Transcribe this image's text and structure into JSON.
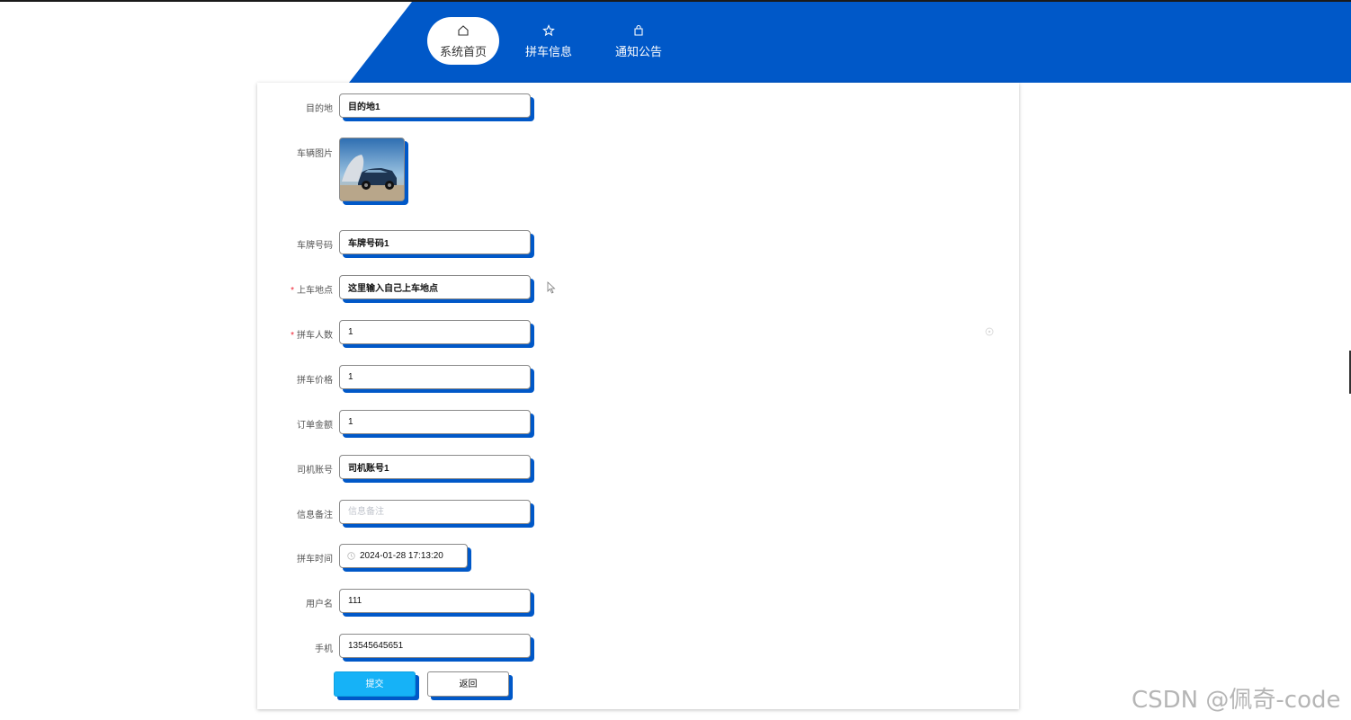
{
  "nav": {
    "items": [
      {
        "label": "系统首页",
        "icon": "home-icon",
        "active": true
      },
      {
        "label": "拼车信息",
        "icon": "star-icon",
        "active": false
      },
      {
        "label": "通知公告",
        "icon": "bag-icon",
        "active": false
      }
    ]
  },
  "colors": {
    "primary": "#0058c8",
    "submit": "#16b2f7",
    "required": "#ee2233"
  },
  "form": {
    "destination": {
      "label": "目的地",
      "value": "目的地1"
    },
    "vehicle_image": {
      "label": "车辆图片"
    },
    "plate": {
      "label": "车牌号码",
      "value": "车牌号码1"
    },
    "pickup": {
      "label": "上车地点",
      "value": "这里输入自己上车地点",
      "required": "*"
    },
    "passengers": {
      "label": "拼车人数",
      "value": "1",
      "required": "*"
    },
    "price": {
      "label": "拼车价格",
      "value": "1"
    },
    "amount": {
      "label": "订单金额",
      "value": "1"
    },
    "driver": {
      "label": "司机账号",
      "value": "司机账号1"
    },
    "remark": {
      "label": "信息备注",
      "placeholder": "信息备注",
      "value": ""
    },
    "time": {
      "label": "拼车时间",
      "value": "2024-01-28 17:13:20"
    },
    "username": {
      "label": "用户名",
      "value": "111"
    },
    "phone": {
      "label": "手机",
      "value": "13545645651"
    }
  },
  "buttons": {
    "submit": "提交",
    "back": "返回"
  },
  "watermark": "CSDN @佩奇-code"
}
